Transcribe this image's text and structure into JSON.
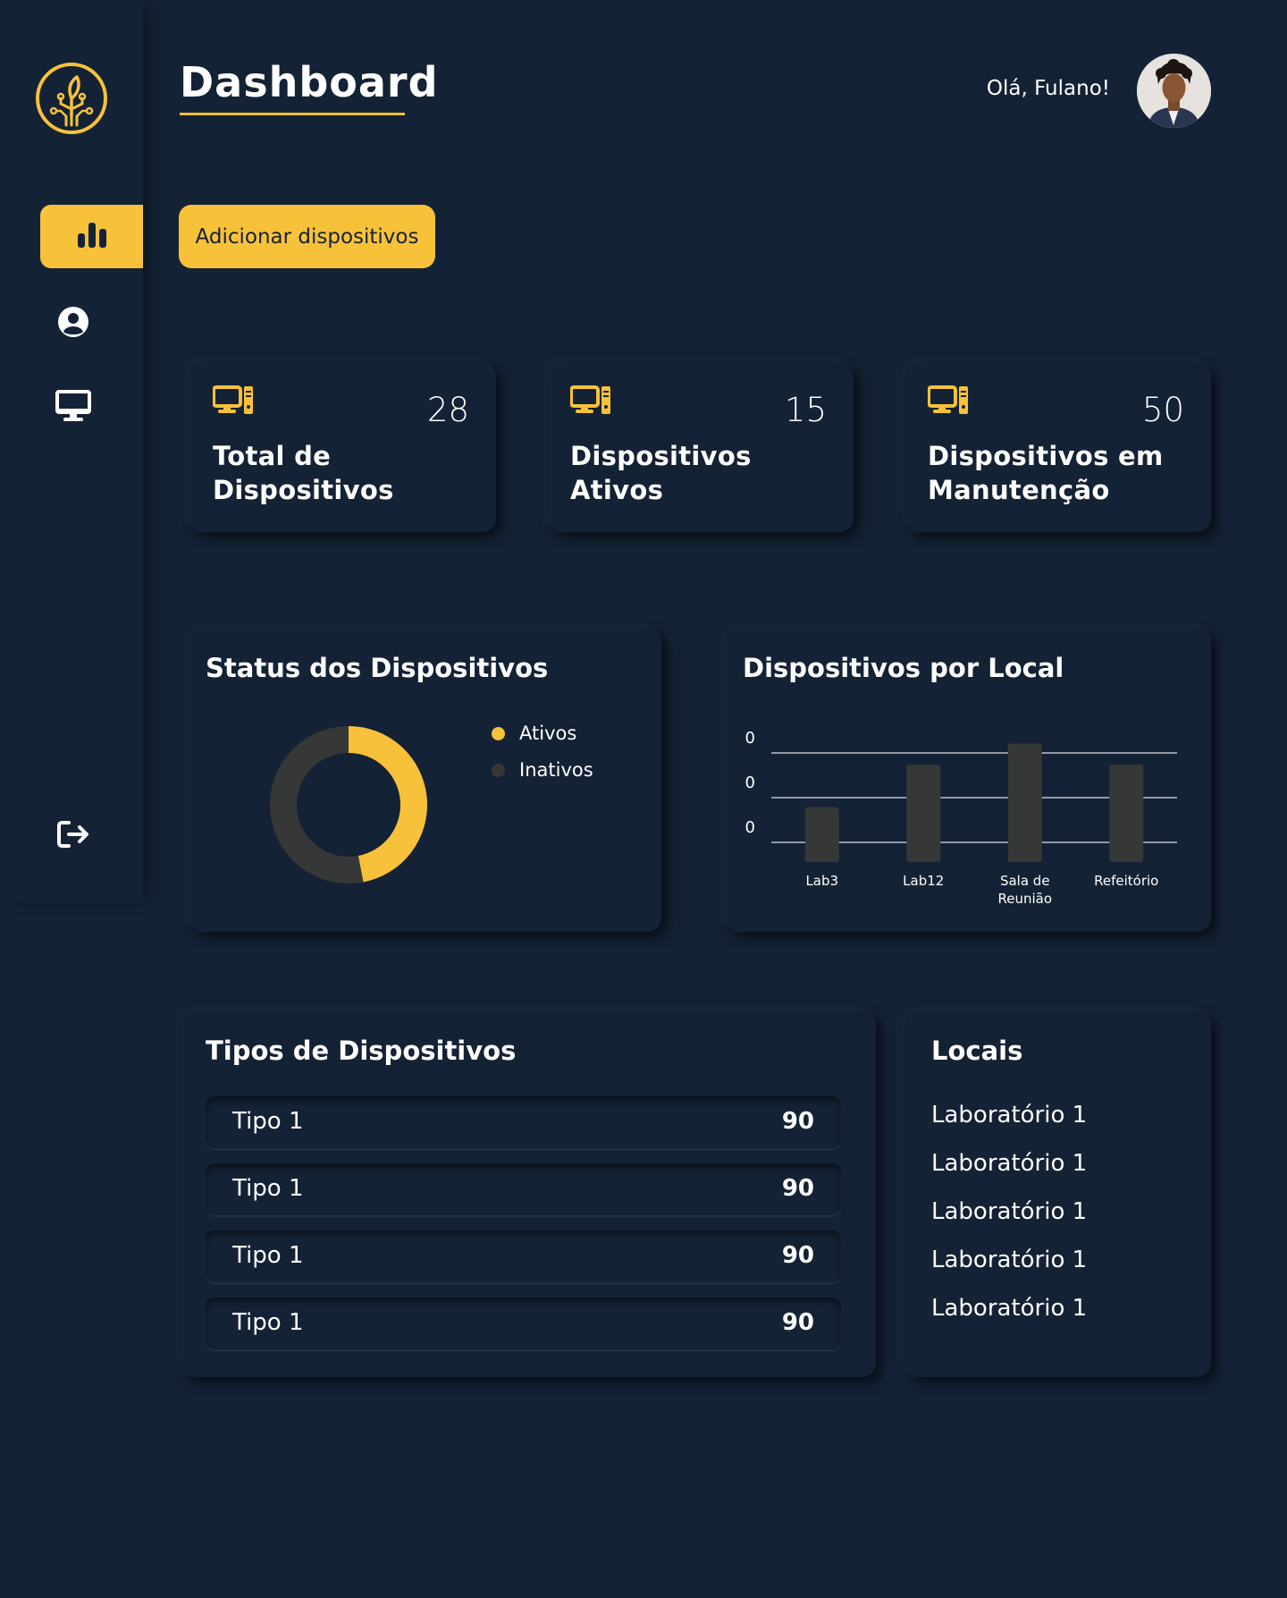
{
  "app": {
    "title": "Dashboard",
    "greeting": "Olá, Fulano!"
  },
  "colors": {
    "background": "#142235",
    "accent": "#f8c13a",
    "inactive": "#363838",
    "text": "#ffffff"
  },
  "sidebar": {
    "logo_icon": "leaf-circuit-logo",
    "items": [
      {
        "icon": "bar-chart-icon",
        "active": true
      },
      {
        "icon": "user-circle-icon",
        "active": false
      },
      {
        "icon": "monitor-icon",
        "active": false
      }
    ],
    "logout_icon": "logout-icon"
  },
  "toolbar": {
    "add_label": "Adicionar dispositivos"
  },
  "stats": [
    {
      "value": "28",
      "label_line1": "Total de",
      "label_line2": "Dispositivos",
      "icon": "computer-icon"
    },
    {
      "value": "15",
      "label_line1": "Dispositivos",
      "label_line2": "Ativos",
      "icon": "computer-icon"
    },
    {
      "value": "50",
      "label_line1": "Dispositivos em",
      "label_line2": "Manutenção",
      "icon": "computer-icon"
    }
  ],
  "status_card": {
    "title": "Status dos Dispositivos",
    "legend": [
      {
        "label": "Ativos",
        "color": "#f8c13a"
      },
      {
        "label": "Inativos",
        "color": "#363838"
      }
    ]
  },
  "location_card": {
    "title": "Dispositivos por Local"
  },
  "types_card": {
    "title": "Tipos de Dispositivos",
    "rows": [
      {
        "label": "Tipo 1",
        "value": "90"
      },
      {
        "label": "Tipo 1",
        "value": "90"
      },
      {
        "label": "Tipo 1",
        "value": "90"
      },
      {
        "label": "Tipo 1",
        "value": "90"
      }
    ]
  },
  "locals_card": {
    "title": "Locais",
    "items": [
      "Laboratório 1",
      "Laboratório 1",
      "Laboratório 1",
      "Laboratório 1",
      "Laboratório 1"
    ]
  },
  "chart_data": [
    {
      "type": "pie",
      "title": "Status dos Dispositivos",
      "categories": [
        "Ativos",
        "Inativos"
      ],
      "values": [
        47,
        53
      ],
      "colors": [
        "#f8c13a",
        "#363838"
      ],
      "donut": true,
      "legend": "right"
    },
    {
      "type": "bar",
      "title": "Dispositivos por Local",
      "categories": [
        "Lab3",
        "Lab12",
        "Sala de Reunião",
        "Refeitório"
      ],
      "category_lines": [
        [
          "Lab3"
        ],
        [
          "Lab12"
        ],
        [
          "Sala de",
          "Reunião"
        ],
        [
          "Refeitório"
        ]
      ],
      "values": [
        1.3,
        2.3,
        2.8,
        2.3
      ],
      "y_tick_labels": [
        "0",
        "0",
        "0"
      ],
      "grid": true,
      "bar_color": "#363838"
    }
  ]
}
